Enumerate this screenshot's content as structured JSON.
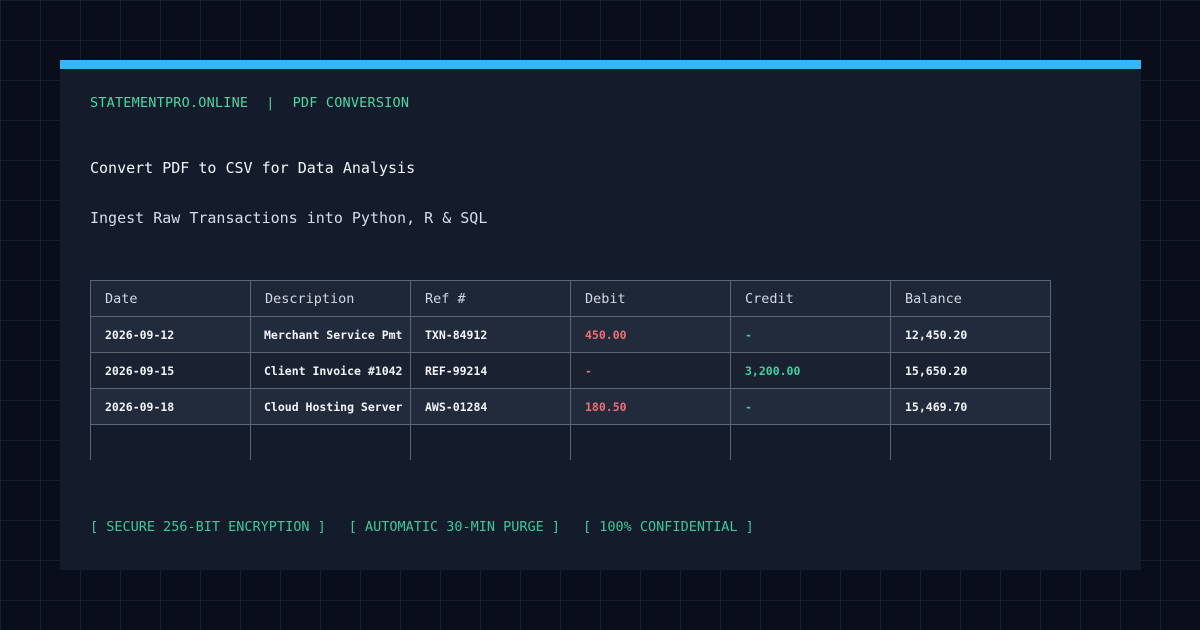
{
  "header": {
    "brand": "STATEMENTPRO.ONLINE",
    "separator": "|",
    "section": "PDF CONVERSION"
  },
  "title": "Convert PDF to CSV for Data Analysis",
  "subtitle": "Ingest Raw Transactions into Python, R & SQL",
  "table": {
    "columns": [
      "Date",
      "Description",
      "Ref #",
      "Debit",
      "Credit",
      "Balance"
    ],
    "rows": [
      {
        "date": "2026-09-12",
        "description": "Merchant Service Pmt",
        "ref": "TXN-84912",
        "debit": "450.00",
        "credit": "-",
        "balance": "12,450.20"
      },
      {
        "date": "2026-09-15",
        "description": "Client Invoice #1042",
        "ref": "REF-99214",
        "debit": "-",
        "credit": "3,200.00",
        "balance": "15,650.20"
      },
      {
        "date": "2026-09-18",
        "description": "Cloud Hosting Server",
        "ref": "AWS-01284",
        "debit": "180.50",
        "credit": "-",
        "balance": "15,469.70"
      }
    ]
  },
  "badges": [
    "[ SECURE 256-BIT ENCRYPTION ]",
    "[ AUTOMATIC 30-MIN PURGE ]",
    "[ 100% CONFIDENTIAL ]"
  ],
  "colors": {
    "accent_bar": "#38b6f4",
    "brand_text": "#4fd6a4",
    "debit": "#f26d76",
    "credit": "#3fd1a0",
    "background": "#090e1a",
    "card": "#141c2b"
  }
}
